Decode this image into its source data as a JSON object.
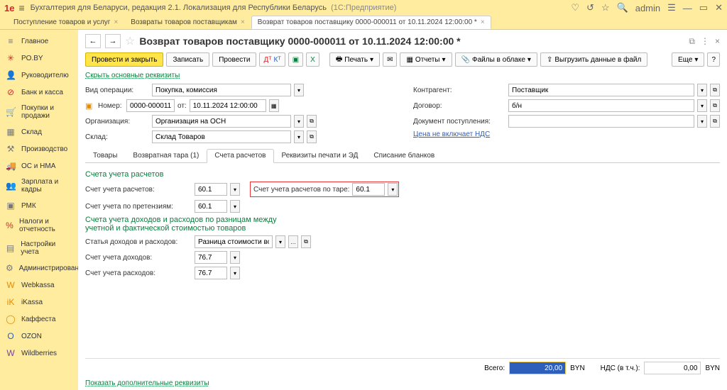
{
  "titlebar": {
    "logo": "1e",
    "title": "Бухгалтерия для Беларуси, редакция 2.1. Локализация для Республики Беларусь",
    "mode": "(1С:Предприятие)",
    "user": "admin"
  },
  "window_tabs": [
    {
      "label": "Поступление товаров и услуг",
      "active": false
    },
    {
      "label": "Возвраты товаров поставщикам",
      "active": false
    },
    {
      "label": "Возврат товаров поставщику 0000-000011 от 10.11.2024 12:00:00 *",
      "active": true
    }
  ],
  "sidebar": [
    {
      "label": "Главное",
      "icon": "≡",
      "cls": "icn-gray"
    },
    {
      "label": "PO.BY",
      "icon": "✳",
      "cls": "icn-red"
    },
    {
      "label": "Руководителю",
      "icon": "👤",
      "cls": "icn-gray"
    },
    {
      "label": "Банк и касса",
      "icon": "⊘",
      "cls": "icn-red"
    },
    {
      "label": "Покупки и продажи",
      "icon": "🛒",
      "cls": "icn-gray"
    },
    {
      "label": "Склад",
      "icon": "▦",
      "cls": "icn-gray"
    },
    {
      "label": "Производство",
      "icon": "⚒",
      "cls": "icn-gray"
    },
    {
      "label": "ОС и НМА",
      "icon": "🚚",
      "cls": "icn-gray"
    },
    {
      "label": "Зарплата и кадры",
      "icon": "👥",
      "cls": "icn-gray"
    },
    {
      "label": "РМК",
      "icon": "▣",
      "cls": "icn-gray"
    },
    {
      "label": "Налоги и отчетность",
      "icon": "%",
      "cls": "icn-red"
    },
    {
      "label": "Настройки учета",
      "icon": "▤",
      "cls": "icn-gray"
    },
    {
      "label": "Администрирование",
      "icon": "⚙",
      "cls": "icn-gray"
    },
    {
      "label": "Webkassa",
      "icon": "W",
      "cls": "icn-orange"
    },
    {
      "label": "iKassa",
      "icon": "iK",
      "cls": "icn-orange"
    },
    {
      "label": "Каффеста",
      "icon": "◯",
      "cls": "icn-orange"
    },
    {
      "label": "OZON",
      "icon": "O",
      "cls": "icn-blue"
    },
    {
      "label": "Wildberries",
      "icon": "W",
      "cls": "icn-purple"
    }
  ],
  "header": {
    "title": "Возврат товаров поставщику 0000-000011 от 10.11.2024 12:00:00 *"
  },
  "toolbar": {
    "post_close": "Провести и закрыть",
    "write": "Записать",
    "post": "Провести",
    "print": "Печать",
    "reports": "Отчеты",
    "files_cloud": "Файлы в облаке",
    "export_file": "Выгрузить данные в файл",
    "more": "Еще"
  },
  "subtoolbar": {
    "hide_main": "Скрыть основные реквизиты"
  },
  "form_left": {
    "op_type_lbl": "Вид операции:",
    "op_type": "Покупка, комиссия",
    "num_lbl": "Номер:",
    "num": "0000-000011",
    "from_lbl": "от:",
    "date": "10.11.2024 12:00:00",
    "org_lbl": "Организация:",
    "org": "Организация на ОСН",
    "wh_lbl": "Склад:",
    "wh": "Склад Товаров"
  },
  "form_right": {
    "counterparty_lbl": "Контрагент:",
    "counterparty": "Поставщик",
    "contract_lbl": "Договор:",
    "contract": "б/н",
    "receipt_lbl": "Документ поступления:",
    "receipt": "",
    "vat_note": "Цена не включает НДС"
  },
  "inner_tabs": {
    "goods": "Товары",
    "tare": "Возвратная тара (1)",
    "accounts": "Счета расчетов",
    "print_ed": "Реквизиты печати и ЭД",
    "blanks": "Списание бланков"
  },
  "accounts_panel": {
    "h1": "Счета учета расчетов",
    "acc_lbl": "Счет учета расчетов:",
    "acc_val": "60.1",
    "tare_lbl": "Счет учета расчетов по таре:",
    "tare_val": "60.1",
    "claim_lbl": "Счет учета  по претензиям:",
    "claim_val": "60.1",
    "h2": "Счета учета доходов и расходов по разницам между учетной и фактической стоимостью товаров",
    "art_lbl": "Статья доходов и расходов:",
    "art_val": "Разница стоимости во",
    "inc_lbl": "Счет учета доходов:",
    "inc_val": "76.7",
    "exp_lbl": "Счет учета расходов:",
    "exp_val": "76.7"
  },
  "footer": {
    "show_more": "Показать дополнительные реквизиты",
    "total_lbl": "Всего:",
    "total_val": "20,00",
    "cur1": "BYN",
    "vat_lbl": "НДС (в т.ч.):",
    "vat_val": "0,00",
    "cur2": "BYN"
  }
}
